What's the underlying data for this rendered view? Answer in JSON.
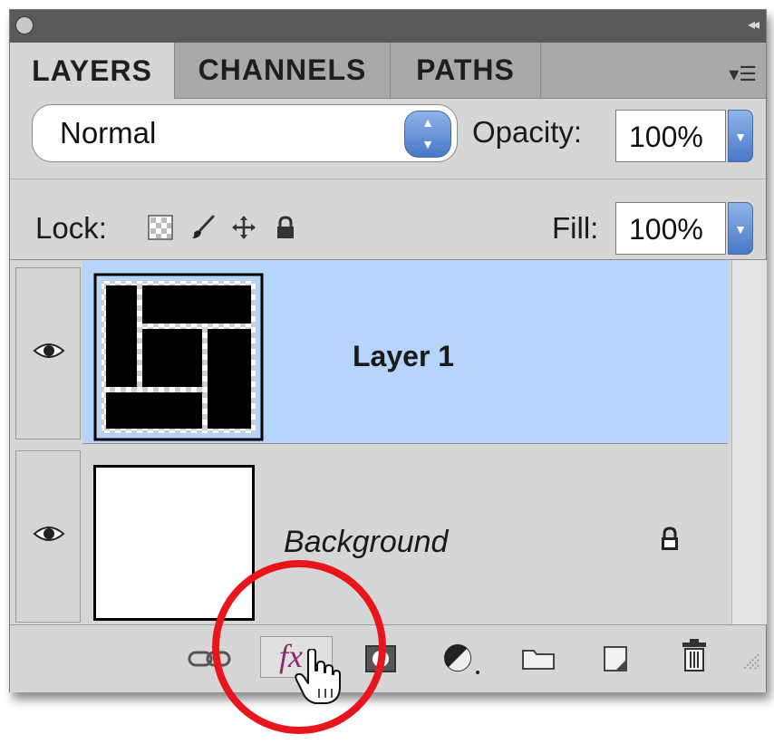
{
  "panel": {
    "tabs": [
      {
        "label": "LAYERS",
        "active": true
      },
      {
        "label": "CHANNELS",
        "active": false
      },
      {
        "label": "PATHS",
        "active": false
      }
    ],
    "menu_icon": "panel-menu-icon"
  },
  "blend_mode": {
    "value": "Normal"
  },
  "opacity": {
    "label": "Opacity:",
    "value": "100%"
  },
  "lock": {
    "label": "Lock:",
    "icons": [
      "lock-transparent-pixels-icon",
      "lock-image-pixels-icon",
      "lock-position-icon",
      "lock-all-icon"
    ]
  },
  "fill": {
    "label": "Fill:",
    "value": "100%"
  },
  "layers": [
    {
      "name": "Layer 1",
      "selected": true,
      "visible": true,
      "thumbnail": "black-rectangles-pattern"
    },
    {
      "name": "Background",
      "selected": false,
      "visible": true,
      "locked": true,
      "thumbnail": "white"
    }
  ],
  "bottom_bar": {
    "buttons": [
      {
        "name": "link-layers-icon"
      },
      {
        "name": "add-layer-style-button",
        "label": "fx"
      },
      {
        "name": "add-layer-mask-icon"
      },
      {
        "name": "adjustment-layer-icon"
      },
      {
        "name": "new-group-icon"
      },
      {
        "name": "new-layer-icon"
      },
      {
        "name": "delete-layer-icon"
      }
    ]
  },
  "colors": {
    "panel_bg": "#d6d6d6",
    "selected_row": "#b6d3fa",
    "highlight_circle": "#e8161c",
    "fx_text": "#8a2a6e"
  }
}
